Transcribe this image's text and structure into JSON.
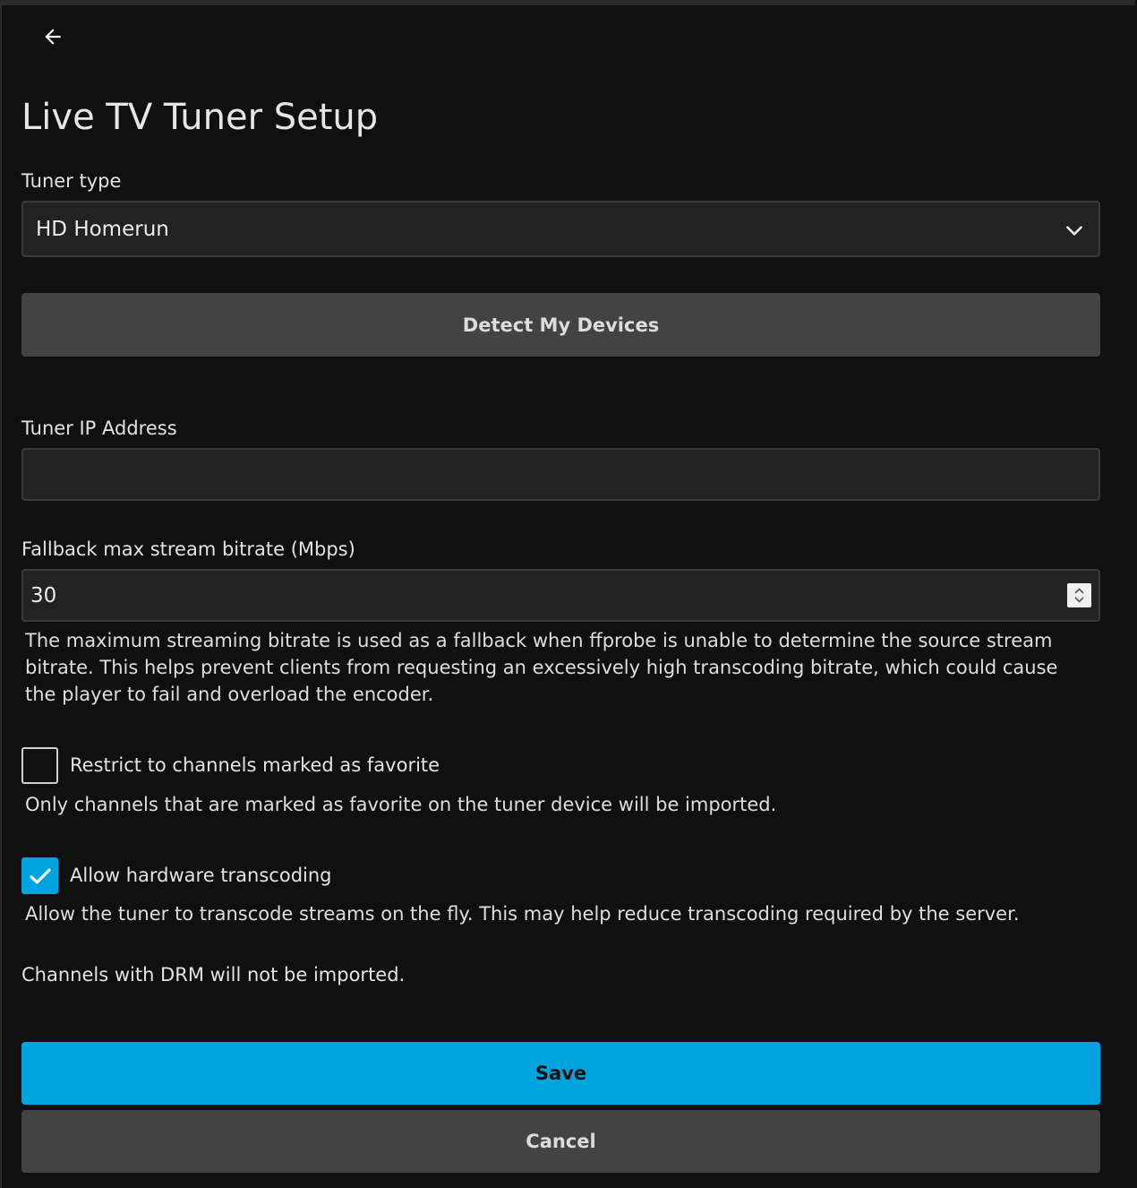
{
  "page": {
    "title": "Live TV Tuner Setup"
  },
  "tuner_type": {
    "label": "Tuner type",
    "selected": "HD Homerun"
  },
  "detect_button": {
    "label": "Detect My Devices"
  },
  "tuner_ip": {
    "label": "Tuner IP Address",
    "value": ""
  },
  "bitrate": {
    "label": "Fallback max stream bitrate (Mbps)",
    "value": "30",
    "help": "The maximum streaming bitrate is used as a fallback when ffprobe is unable to determine the source stream bitrate. This helps prevent clients from requesting an excessively high transcoding bitrate, which could cause the player to fail and overload the encoder."
  },
  "favorites": {
    "label": "Restrict to channels marked as favorite",
    "checked": false,
    "help": "Only channels that are marked as favorite on the tuner device will be imported."
  },
  "hw_transcoding": {
    "label": "Allow hardware transcoding",
    "checked": true,
    "help": "Allow the tuner to transcode streams on the fly. This may help reduce transcoding required by the server."
  },
  "drm_note": "Channels with DRM will not be imported.",
  "actions": {
    "save_label": "Save",
    "cancel_label": "Cancel"
  },
  "icons": {
    "back": "arrow-left-icon",
    "dropdown": "chevron-down-icon",
    "spinner": "number-spinner-icon",
    "check": "checkmark-icon"
  },
  "colors": {
    "background": "#101010",
    "accent": "#00a4dc",
    "button_gray": "#434343",
    "input_bg": "#222222"
  }
}
